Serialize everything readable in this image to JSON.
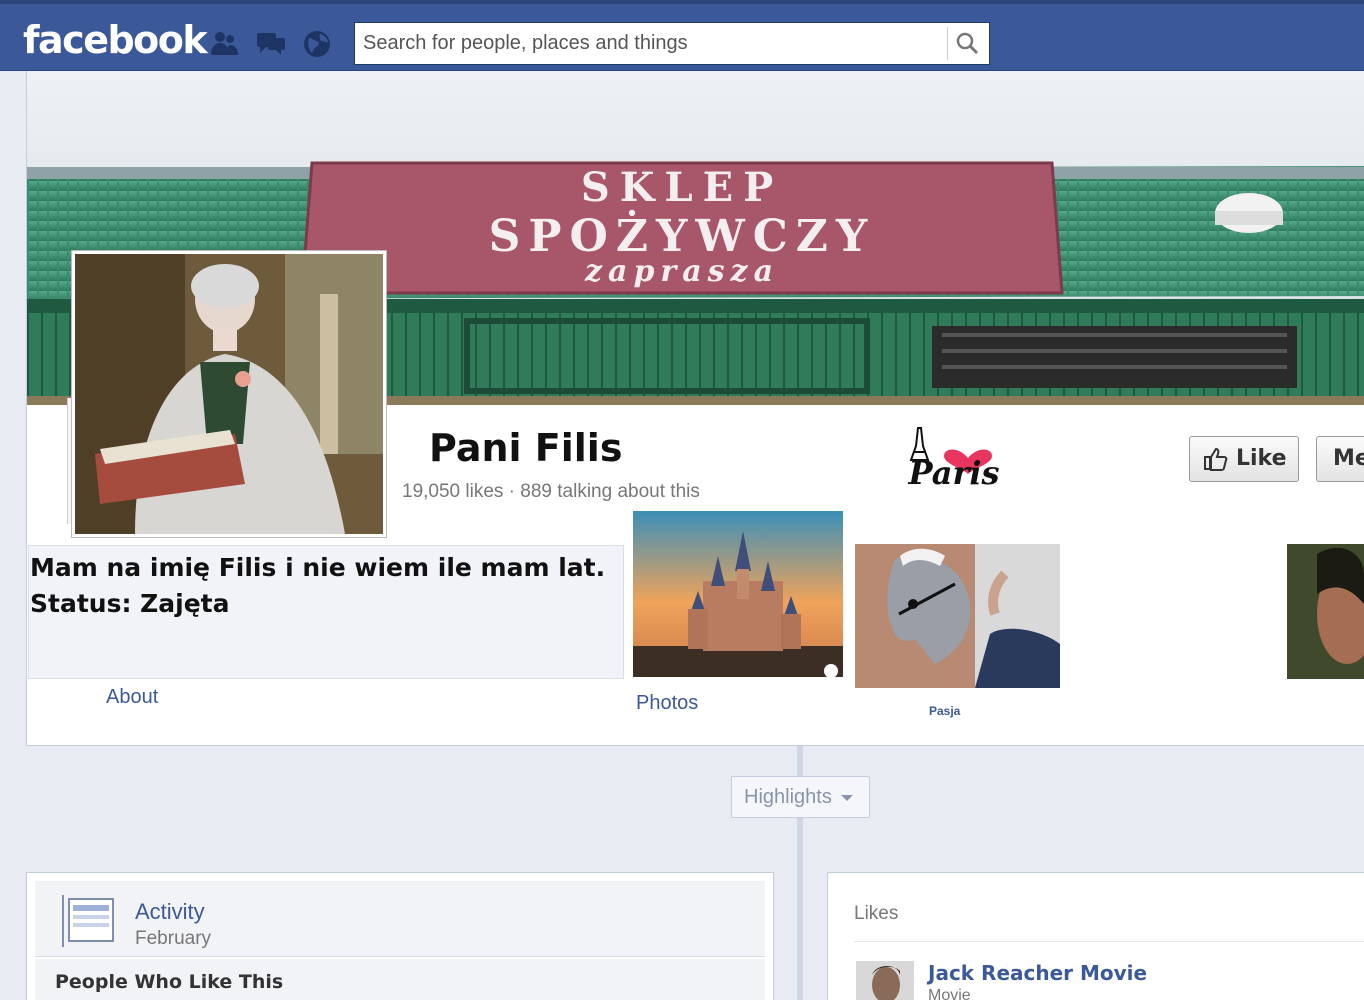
{
  "header": {
    "logo": "facebook",
    "search_placeholder": "Search for people, places and things"
  },
  "cover": {
    "sign_line1": "SKLEP",
    "sign_line2": "SPOŻYWCZY",
    "sign_line3": "zaprasza"
  },
  "page": {
    "name": "Pani Filis",
    "stats": "19,050 likes · 889 talking about this",
    "paris_logo_text": "Paris"
  },
  "actions": {
    "like_label": "Like",
    "message_label": "Me"
  },
  "about": {
    "line1": "Mam na imię Filis i nie wiem ile mam lat.",
    "line2": "Status: Zajęta",
    "label": "About"
  },
  "apps": {
    "photos_label": "Photos",
    "pasja_label": "Pasja"
  },
  "timeline": {
    "highlights_label": "Highlights"
  },
  "activity": {
    "title": "Activity",
    "subtitle": "February",
    "people_label": "People Who Like This"
  },
  "likes": {
    "label": "Likes",
    "items": [
      {
        "name": "Jack Reacher Movie",
        "category": "Movie"
      }
    ]
  },
  "colors": {
    "brand": "#3b5998",
    "background": "#e9ebf2"
  }
}
